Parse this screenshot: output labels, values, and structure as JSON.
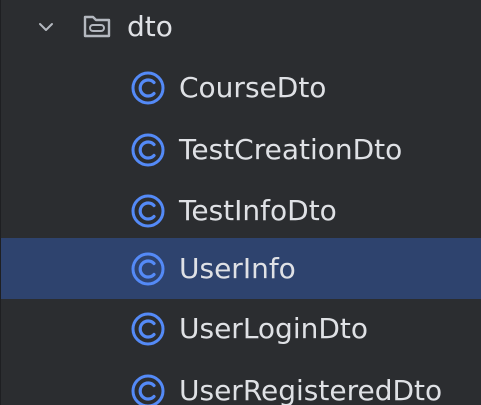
{
  "tree": {
    "folder": {
      "label": "dto",
      "icon": "folder-icon",
      "expand_icon": "chevron-down-icon"
    },
    "items": [
      {
        "label": "CourseDto",
        "icon": "class-icon",
        "selected": false
      },
      {
        "label": "TestCreationDto",
        "icon": "class-icon",
        "selected": false
      },
      {
        "label": "TestInfoDto",
        "icon": "class-icon",
        "selected": false
      },
      {
        "label": "UserInfo",
        "icon": "class-icon",
        "selected": true
      },
      {
        "label": "UserLoginDto",
        "icon": "class-icon",
        "selected": false
      },
      {
        "label": "UserRegisteredDto",
        "icon": "class-icon",
        "selected": false
      }
    ]
  },
  "colors": {
    "background": "#2b2d30",
    "selection": "#2e436e",
    "text": "#dfe1e5",
    "class_icon": "#548af7"
  }
}
